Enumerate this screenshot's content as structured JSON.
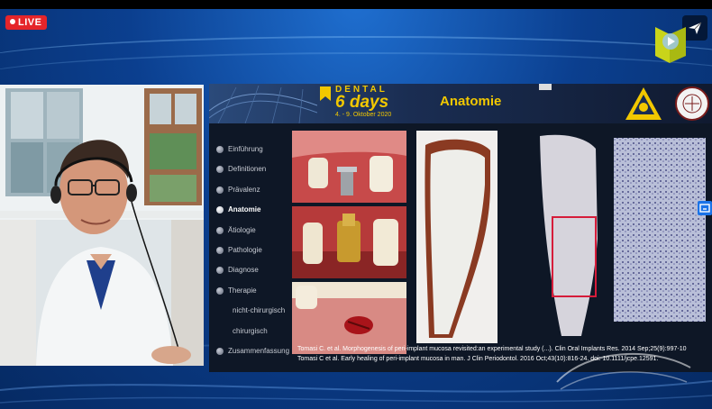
{
  "stream": {
    "live_label": "LIVE"
  },
  "slide": {
    "brand_top": "DENTAL",
    "brand_main": "6 days",
    "brand_date": "4. - 9. Oktober 2020",
    "title": "Anatomie",
    "nav": [
      {
        "label": "Einführung",
        "active": false,
        "sub": false
      },
      {
        "label": "Definitionen",
        "active": false,
        "sub": false
      },
      {
        "label": "Prävalenz",
        "active": false,
        "sub": false
      },
      {
        "label": "Anatomie",
        "active": true,
        "sub": false
      },
      {
        "label": "Ätiologie",
        "active": false,
        "sub": false
      },
      {
        "label": "Pathologie",
        "active": false,
        "sub": false
      },
      {
        "label": "Diagnose",
        "active": false,
        "sub": false
      },
      {
        "label": "Therapie",
        "active": false,
        "sub": false
      },
      {
        "label": "nicht-chirurgisch",
        "active": false,
        "sub": true
      },
      {
        "label": "chirurgisch",
        "active": false,
        "sub": true
      },
      {
        "label": "Zusammenfassung",
        "active": false,
        "sub": false
      }
    ],
    "references": [
      "Tomasi C. et al.  Morphogenesis of peri-implant mucosa revisited:an experimental study (...). Clin Oral Implants Res. 2014 Sep;25(9):997-10",
      "Tomasi C et al. Early healing of peri-implant mucosa in man. J Clin Periodontol. 2016 Oct;43(10):816-24. doi: 10.1111/jcpe.12591."
    ]
  },
  "colors": {
    "live_red": "#e5252a",
    "slide_yellow": "#f2c800",
    "stage_blue": "#0b3f8f"
  },
  "icons": [
    "paper-plane-icon",
    "brand-play-logo-icon",
    "bookmark-logo-icon",
    "triangle-logo-icon",
    "university-seal-icon",
    "screen-share-icon"
  ]
}
